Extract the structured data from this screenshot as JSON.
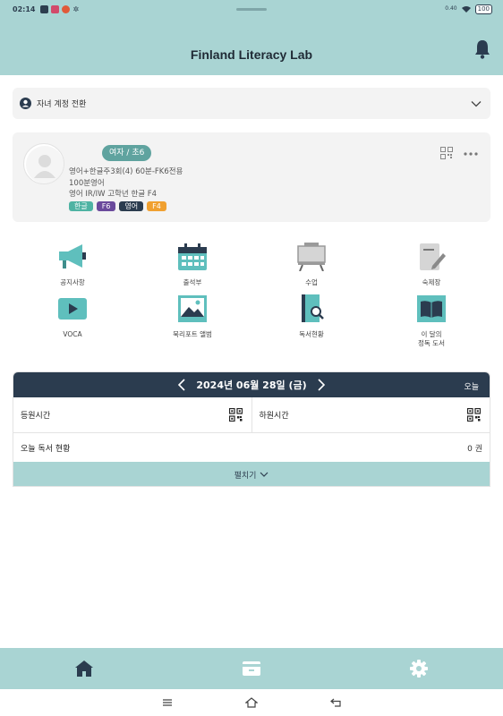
{
  "status_bar": {
    "time": "02:14",
    "battery": "100",
    "net": "0.40\nKB/S"
  },
  "app": {
    "title": "Finland Literacy Lab",
    "bell_icon": "bell-icon"
  },
  "switcher": {
    "label": "자녀 계정 전환",
    "icon": "person-circle-icon"
  },
  "profile": {
    "badge": "여자 / 초6",
    "lines": [
      "영어+한글주3회(4) 60분-FK6전용",
      "100분영어",
      "영어 IR/IW 고학년 한글 F4"
    ],
    "tags": [
      {
        "label": "한글",
        "color": "#4fb3a3"
      },
      {
        "label": "F6",
        "color": "#6a4a9c"
      },
      {
        "label": "영어",
        "color": "#2b3c4f"
      },
      {
        "label": "F4",
        "color": "#f0a030"
      }
    ]
  },
  "menu": [
    {
      "label": "공지사항",
      "icon": "megaphone-icon"
    },
    {
      "label": "출석부",
      "icon": "calendar-icon"
    },
    {
      "label": "수업",
      "icon": "easel-icon"
    },
    {
      "label": "숙제장",
      "icon": "homework-pad-icon"
    },
    {
      "label": "VOCA",
      "icon": "video-play-icon"
    },
    {
      "label": "북리포트 앨범",
      "icon": "picture-album-icon"
    },
    {
      "label": "독서현황",
      "icon": "book-search-icon"
    },
    {
      "label": "이 달의\n정독 도서",
      "line1": "이 달의",
      "line2": "정독 도서",
      "icon": "open-book-icon"
    }
  ],
  "attendance": {
    "date": "2024년 06월 28일 (금)",
    "today": "오늘",
    "check_in": "등원시간",
    "check_out": "하원시간",
    "reading_label": "오늘 독서 현황",
    "reading_count": "0 권",
    "expand": "펼치기"
  },
  "colors": {
    "teal": "#a9d4d3",
    "navy": "#2b3c4f",
    "badge": "#5fa39f"
  }
}
